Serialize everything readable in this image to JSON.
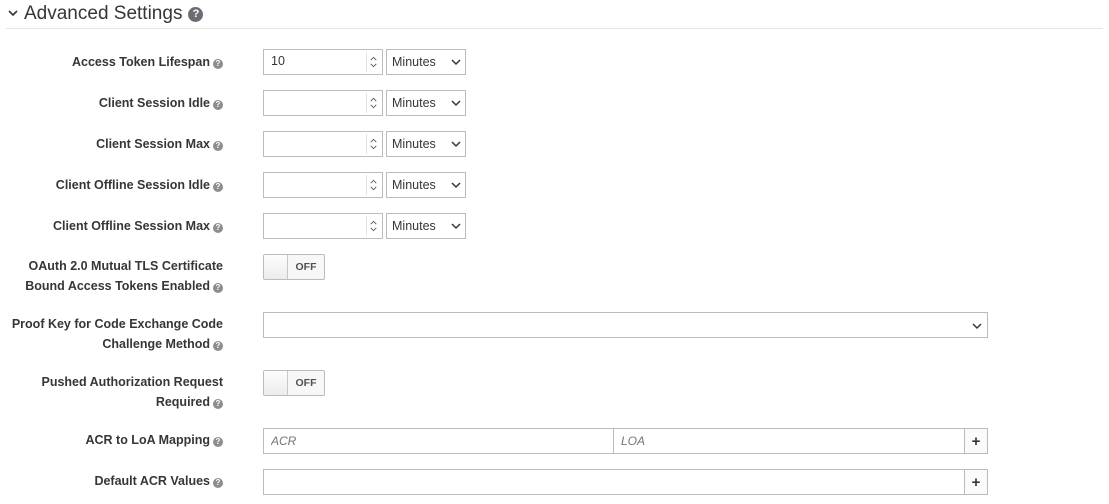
{
  "section": {
    "title": "Advanced Settings",
    "help_icon": "question-circle-icon"
  },
  "fields": {
    "access_token_lifespan": {
      "label": "Access Token Lifespan",
      "value": "10",
      "unit": "Minutes"
    },
    "client_session_idle": {
      "label": "Client Session Idle",
      "value": "",
      "unit": "Minutes"
    },
    "client_session_max": {
      "label": "Client Session Max",
      "value": "",
      "unit": "Minutes"
    },
    "client_offline_session_idle": {
      "label": "Client Offline Session Idle",
      "value": "",
      "unit": "Minutes"
    },
    "client_offline_session_max": {
      "label": "Client Offline Session Max",
      "value": "",
      "unit": "Minutes"
    },
    "mtls_bound_tokens": {
      "label_line1": "OAuth 2.0 Mutual TLS Certificate",
      "label_line2": "Bound Access Tokens Enabled",
      "state": "OFF"
    },
    "pkce_method": {
      "label_line1": "Proof Key for Code Exchange Code",
      "label_line2": "Challenge Method",
      "value": ""
    },
    "par_required": {
      "label_line1": "Pushed Authorization Request",
      "label_line2": "Required",
      "state": "OFF"
    },
    "acr_loa_mapping": {
      "label": "ACR to LoA Mapping",
      "key_placeholder": "ACR",
      "value_placeholder": "LOA",
      "add_symbol": "+"
    },
    "default_acr_values": {
      "label": "Default ACR Values",
      "value": "",
      "add_symbol": "+"
    }
  },
  "help_glyph": "?"
}
